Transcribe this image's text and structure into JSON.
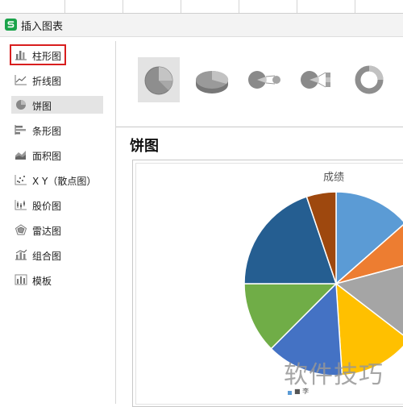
{
  "dialog": {
    "title": "插入图表"
  },
  "sidebar": {
    "items": [
      {
        "label": "柱形图",
        "icon": "column-chart-icon"
      },
      {
        "label": "折线图",
        "icon": "line-chart-icon"
      },
      {
        "label": "饼图",
        "icon": "pie-chart-icon"
      },
      {
        "label": "条形图",
        "icon": "bar-chart-icon"
      },
      {
        "label": "面积图",
        "icon": "area-chart-icon"
      },
      {
        "label": "X Y（散点图）",
        "icon": "scatter-chart-icon"
      },
      {
        "label": "股价图",
        "icon": "stock-chart-icon"
      },
      {
        "label": "雷达图",
        "icon": "radar-chart-icon"
      },
      {
        "label": "组合图",
        "icon": "combo-chart-icon"
      },
      {
        "label": "模板",
        "icon": "template-icon"
      }
    ],
    "selected": "饼图",
    "highlighted": "柱形图"
  },
  "subtypes": [
    "pie",
    "3d-pie",
    "pie-of-pie",
    "bar-of-pie",
    "doughnut"
  ],
  "preview": {
    "heading": "饼图",
    "legend_fragment": "■ 李"
  },
  "chart_data": {
    "type": "pie",
    "title": "成绩",
    "slices": [
      {
        "value": 13,
        "color": "#5b9bd5"
      },
      {
        "value": 7,
        "color": "#ed7d31"
      },
      {
        "value": 14,
        "color": "#a5a5a5"
      },
      {
        "value": 13,
        "color": "#ffc000"
      },
      {
        "value": 13,
        "color": "#4472c4"
      },
      {
        "value": 12,
        "color": "#70ad47"
      },
      {
        "value": 19,
        "color": "#255e91"
      },
      {
        "value": 5,
        "color": "#9e480e"
      }
    ]
  },
  "watermark": "软件技巧",
  "colors": {
    "selection_bg": "#e4e4e4",
    "highlight_border": "#d81e1e",
    "app_icon": "#1aa34a"
  }
}
